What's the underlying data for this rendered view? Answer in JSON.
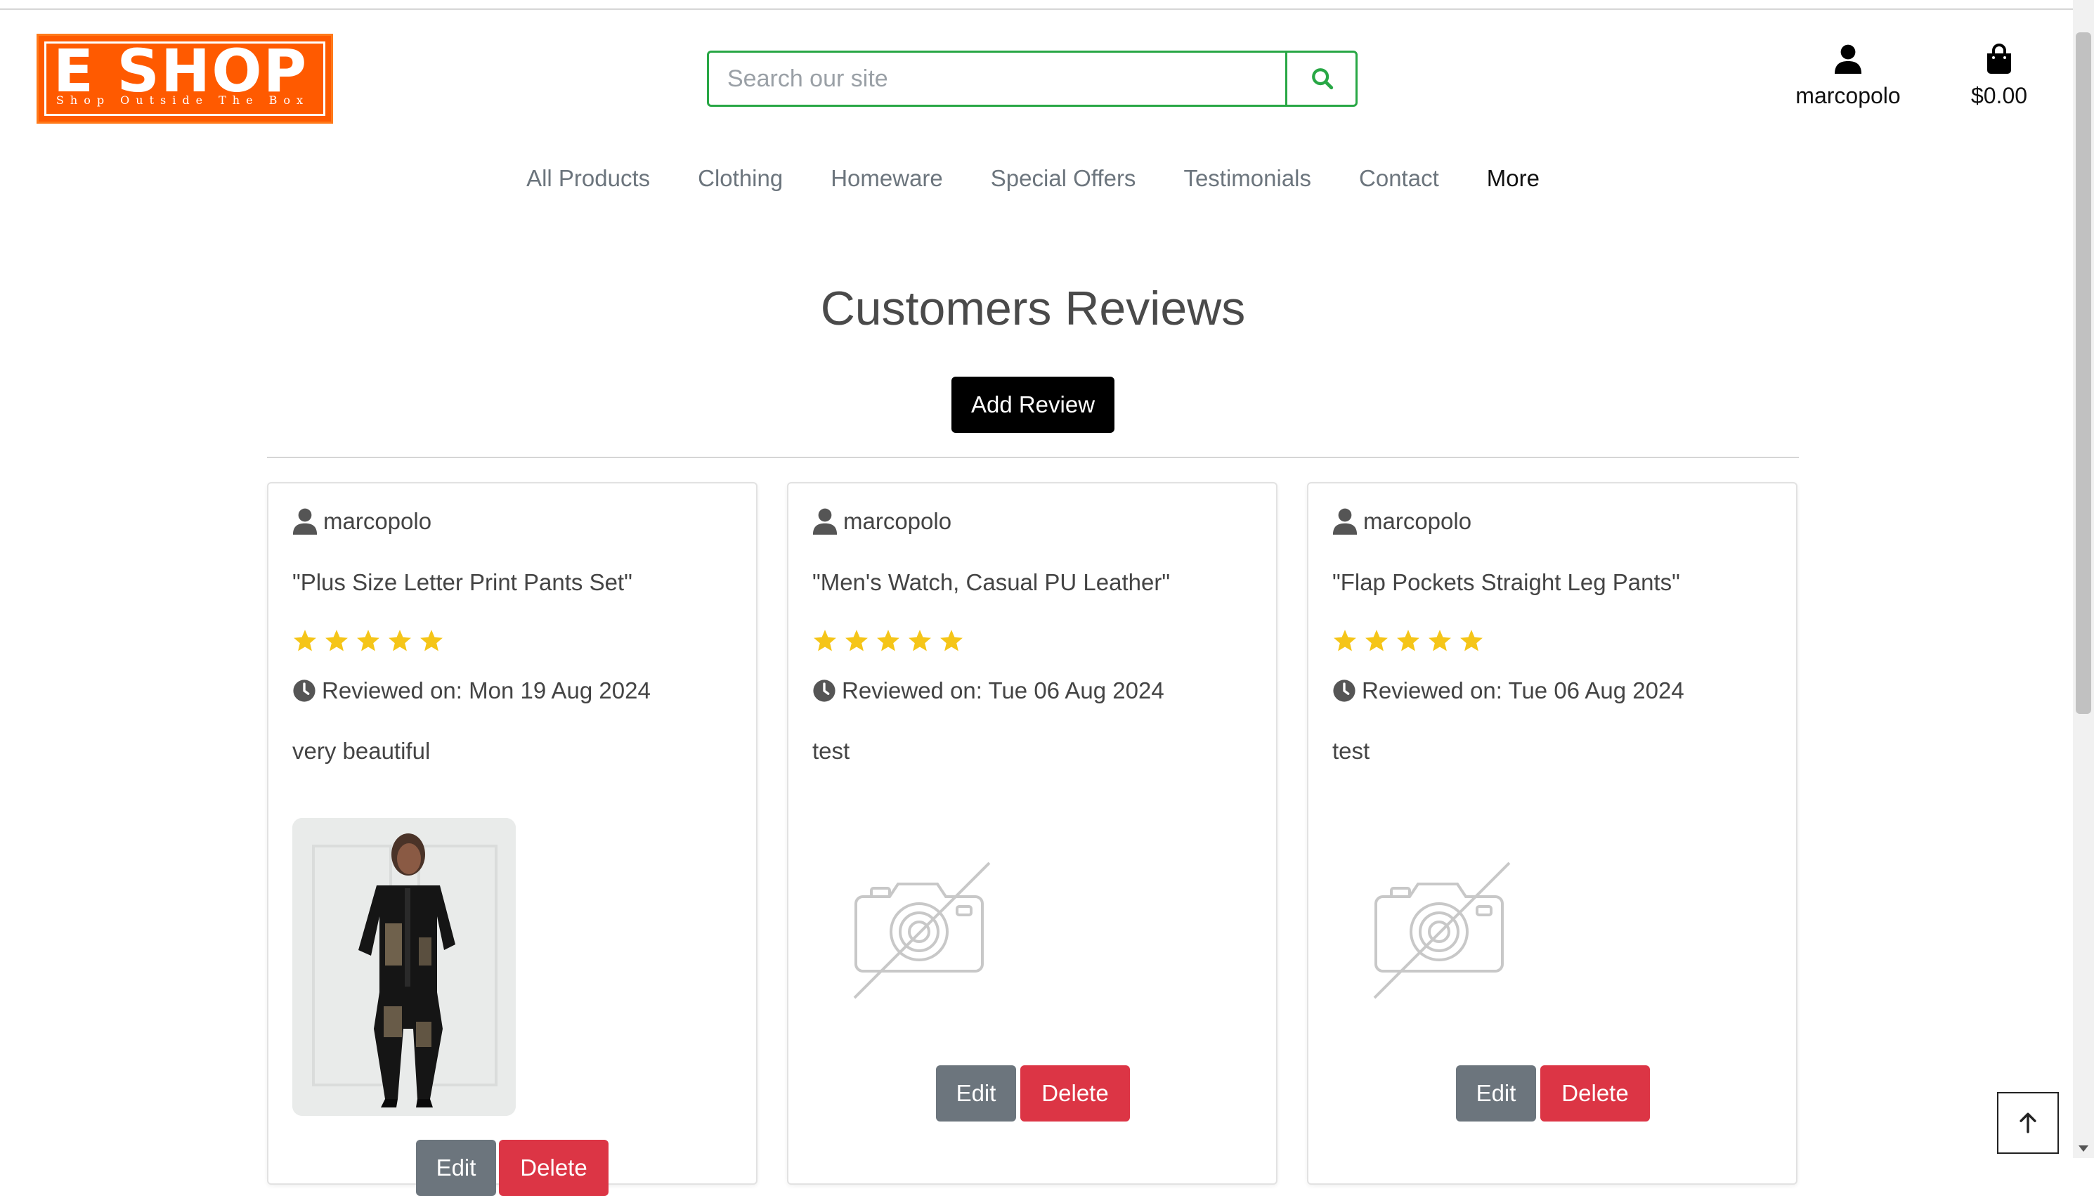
{
  "header": {
    "logo": {
      "text": "E SHOP",
      "tagline": "Shop Outside The Box",
      "color": "#ff5a00"
    },
    "search": {
      "placeholder": "Search our site",
      "icon": "search-icon"
    },
    "account": {
      "label": "marcopolo",
      "icon": "user-icon"
    },
    "cart": {
      "label": "$0.00",
      "icon": "shopping-bag-icon"
    }
  },
  "nav": {
    "items": [
      {
        "label": "All Products"
      },
      {
        "label": "Clothing"
      },
      {
        "label": "Homeware"
      },
      {
        "label": "Special Offers"
      },
      {
        "label": "Testimonials"
      },
      {
        "label": "Contact"
      },
      {
        "label": "More"
      }
    ]
  },
  "main": {
    "title": "Customers Reviews",
    "add_review_label": "Add Review",
    "reviews": [
      {
        "user": "marcopolo",
        "product": "\"Plus Size Letter Print Pants Set\"",
        "rating": 5,
        "date": "Reviewed on: Mon 19 Aug 2024",
        "text": "very beautiful",
        "has_image": true,
        "edit_label": "Edit",
        "delete_label": "Delete"
      },
      {
        "user": "marcopolo",
        "product": "\"Men's Watch, Casual PU Leather\"",
        "rating": 5,
        "date": "Reviewed on: Tue 06 Aug 2024",
        "text": "test",
        "has_image": false,
        "edit_label": "Edit",
        "delete_label": "Delete"
      },
      {
        "user": "marcopolo",
        "product": "\"Flap Pockets Straight Leg Pants\"",
        "rating": 5,
        "date": "Reviewed on: Tue 06 Aug 2024",
        "text": "test",
        "has_image": false,
        "edit_label": "Edit",
        "delete_label": "Delete"
      }
    ]
  },
  "colors": {
    "star": "#f5c518",
    "edit_button": "#6c757d",
    "delete_button": "#dc3545",
    "search_border": "#28a745",
    "add_review_button": "#000000"
  },
  "icons": {
    "back_to_top": "arrow-up-icon",
    "review_user": "user-icon",
    "review_date": "clock-icon",
    "no_image": "camera-off-icon"
  }
}
